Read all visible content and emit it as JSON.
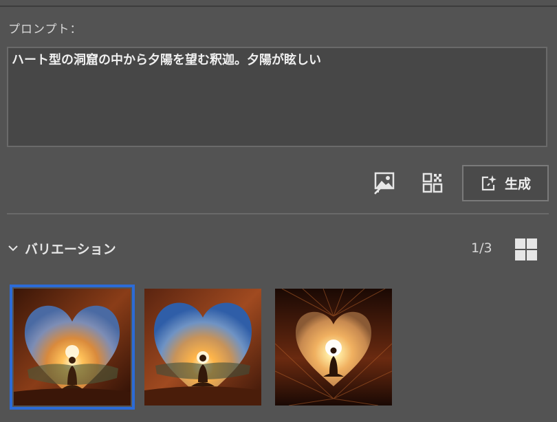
{
  "prompt": {
    "label": "プロンプト：",
    "text": "ハート型の洞窟の中から夕陽を望む釈迦。夕陽が眩しい"
  },
  "toolbar": {
    "reference_image_icon": "image-reference-icon",
    "qr_icon": "qr-code-icon",
    "generate_icon": "sparkle-generate-icon",
    "generate_label": "生成"
  },
  "variations": {
    "title": "バリエーション",
    "page": "1/3",
    "chevron_icon": "chevron-down-icon",
    "grid_icon": "grid-view-icon",
    "selected_index": 0,
    "selection_color": "#2c6bd7"
  }
}
